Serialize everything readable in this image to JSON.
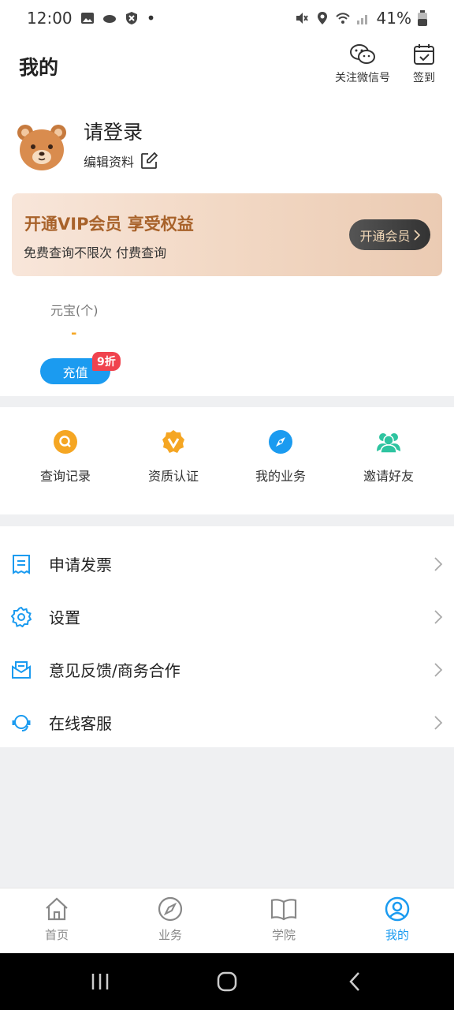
{
  "status_bar": {
    "time": "12:00",
    "battery": "41%"
  },
  "header": {
    "title": "我的",
    "wechat_label": "关注微信号",
    "checkin_label": "签到"
  },
  "profile": {
    "login_text": "请登录",
    "edit_label": "编辑资料",
    "avatar_icon": "bear-avatar-icon"
  },
  "vip": {
    "title": "开通VIP会员 享受权益",
    "subtitle": "免费查询不限次 付费查询",
    "button_label": "开通会员"
  },
  "wallet": {
    "label": "元宝(个)",
    "value": "-",
    "recharge_label": "充值",
    "discount_badge": "9折"
  },
  "quick_actions": [
    {
      "label": "查询记录",
      "icon": "search-icon",
      "color": "#f5a623"
    },
    {
      "label": "资质认证",
      "icon": "verified-badge-icon",
      "color": "#f5a623"
    },
    {
      "label": "我的业务",
      "icon": "compass-icon",
      "color": "#1b9bf0"
    },
    {
      "label": "邀请好友",
      "icon": "friends-icon",
      "color": "#2ec4a0"
    }
  ],
  "menu": [
    {
      "label": "申请发票",
      "icon": "invoice-icon"
    },
    {
      "label": "设置",
      "icon": "gear-icon"
    },
    {
      "label": "意见反馈/商务合作",
      "icon": "mail-icon"
    },
    {
      "label": "在线客服",
      "icon": "headset-icon"
    }
  ],
  "tabs": [
    {
      "label": "首页",
      "icon": "home-icon"
    },
    {
      "label": "业务",
      "icon": "compass-icon"
    },
    {
      "label": "学院",
      "icon": "book-icon"
    },
    {
      "label": "我的",
      "icon": "user-circle-icon",
      "active": true
    }
  ],
  "colors": {
    "accent": "#1b9bf0",
    "gold": "#f5a623",
    "vip_text": "#a8622a",
    "badge": "#f0434e"
  }
}
